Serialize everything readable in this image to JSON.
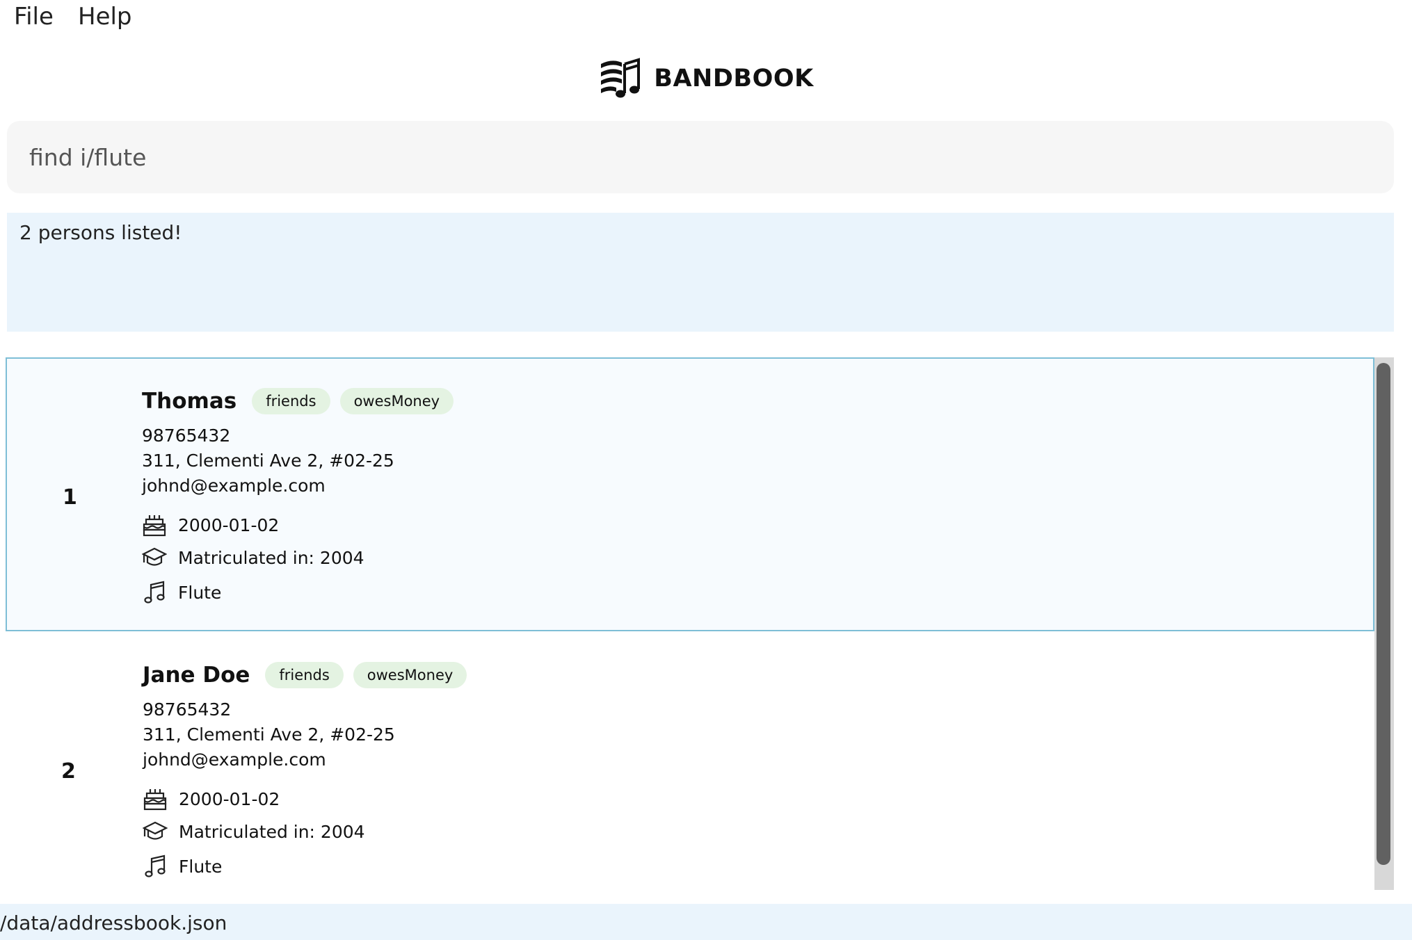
{
  "menu": {
    "file": "File",
    "help": "Help"
  },
  "app": {
    "title": "BANDBOOK"
  },
  "command": {
    "value": "find i/flute",
    "placeholder": ""
  },
  "result": {
    "message": "2 persons listed!"
  },
  "persons": [
    {
      "index": "1",
      "name": "Thomas",
      "tags": [
        "friends",
        "owesMoney"
      ],
      "phone": "98765432",
      "address": "311, Clementi Ave 2, #02-25",
      "email": "johnd@example.com",
      "birthday": "2000-01-02",
      "matriculation": "Matriculated in: 2004",
      "instrument": "Flute"
    },
    {
      "index": "2",
      "name": "Jane Doe",
      "tags": [
        "friends",
        "owesMoney"
      ],
      "phone": "98765432",
      "address": "311, Clementi Ave 2, #02-25",
      "email": "johnd@example.com",
      "birthday": "2000-01-02",
      "matriculation": "Matriculated in: 2004",
      "instrument": "Flute"
    }
  ],
  "status": {
    "path": "/data/addressbook.json"
  },
  "icons": {
    "logo": "music-notes-logo-icon",
    "birthday": "cake-icon",
    "matriculation": "graduation-cap-icon",
    "instrument": "music-note-icon"
  }
}
